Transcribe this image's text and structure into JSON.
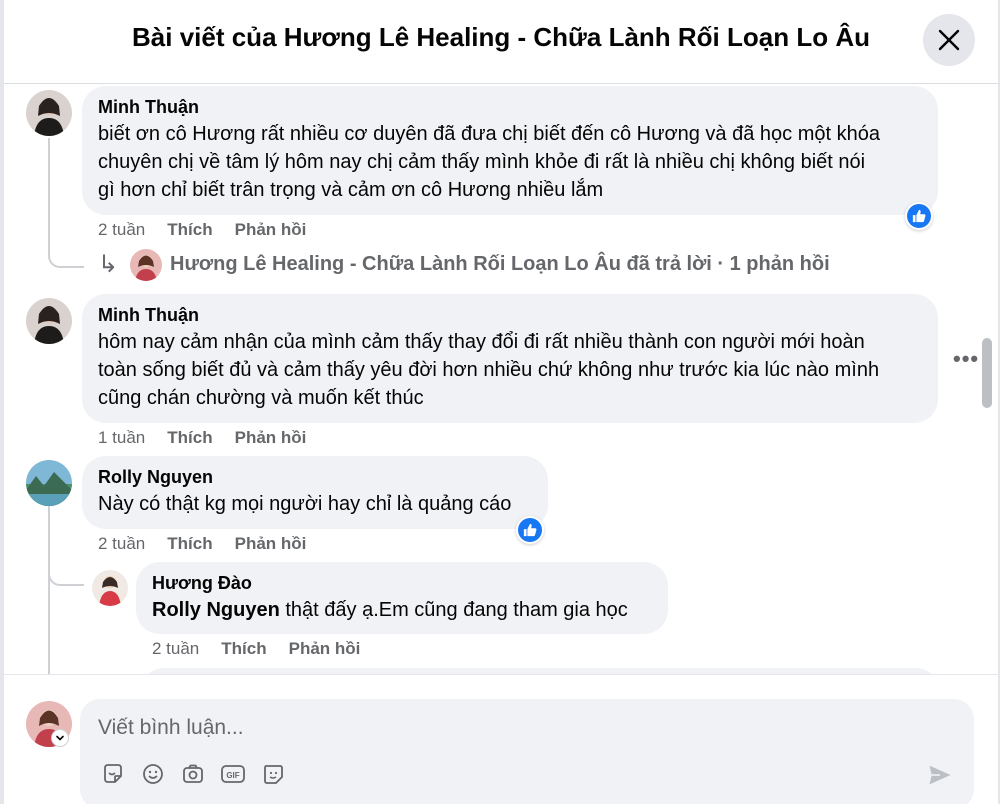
{
  "modal": {
    "title": "Bài viết của Hương Lê Healing - Chữa Lành Rối Loạn Lo Âu"
  },
  "comments": [
    {
      "author": "Minh Thuận",
      "lines": [
        "biết ơn cô Hương rất nhiều cơ duyên đã đưa chị biết đến cô Hương và đã học một khóa",
        "chuyên chị về tâm lý hôm nay chị cảm thấy mình khỏe đi rất là nhiều chị không biết nói",
        "gì hơn chỉ biết trân trọng và cảm ơn cô Hương nhiều lắm"
      ],
      "time": "2 tuần",
      "like_label": "Thích",
      "reply_label": "Phản hồi",
      "reactions_icon": "like-icon",
      "reply_summary": "Hương Lê Healing - Chữa Lành Rối Loạn Lo Âu đã trả lời · 1 phản hồi"
    },
    {
      "author": "Minh Thuận",
      "lines": [
        "hôm nay cảm nhận của mình cảm thấy thay đổi đi rất nhiều thành con người mới hoàn",
        "toàn sống biết đủ và cảm thấy yêu đời hơn nhiều chứ không như trước kia lúc nào mình",
        "cũng chán chường và muốn kết thúc"
      ],
      "time": "1 tuần",
      "like_label": "Thích",
      "reply_label": "Phản hồi",
      "more_label": "•••"
    },
    {
      "author": "Rolly Nguyen",
      "lines": [
        "Này có thật kg mọi người hay chỉ là quảng cáo"
      ],
      "time": "2 tuần",
      "like_label": "Thích",
      "reply_label": "Phản hồi",
      "reactions_icon": "like-icon",
      "replies": [
        {
          "author": "Hương Đào",
          "mention": "Rolly Nguyen",
          "text": " thật đấy ạ.Em cũng đang tham gia học",
          "time": "2 tuần",
          "like_label": "Thích",
          "reply_label": "Phản hồi"
        }
      ]
    }
  ],
  "composer": {
    "placeholder": "Viết bình luận...",
    "tools": [
      "sticker-icon",
      "emoji-icon",
      "camera-icon",
      "gif-icon",
      "avatar-sticker-icon"
    ],
    "send_icon": "send-icon"
  },
  "colors": {
    "like_blue": "#1877f2",
    "bubble_gray": "#f0f2f5",
    "secondary_text": "#65676b"
  }
}
